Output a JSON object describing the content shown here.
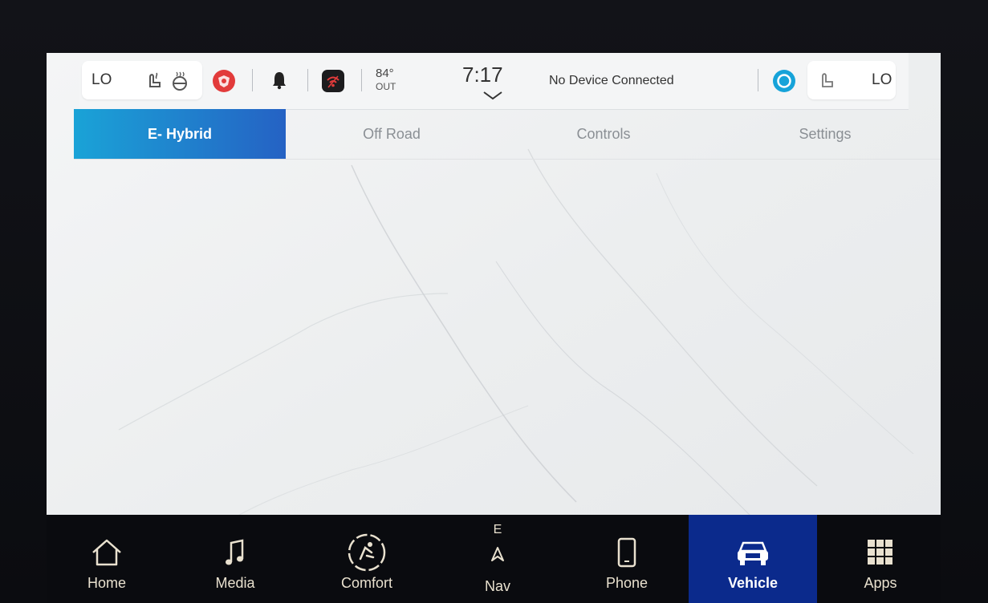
{
  "status_bar": {
    "left_climate_level": "LO",
    "right_climate_level": "LO",
    "temperature": "84°",
    "temperature_label": "OUT",
    "time": "7:17",
    "device_status": "No Device Connected",
    "icons": [
      "seat-heat-icon",
      "steering-wheel-heat-icon",
      "srt-logo-icon",
      "notification-bell-icon",
      "wifi-hotspot-icon",
      "chevron-down-icon",
      "alexa-icon",
      "seat-vent-icon"
    ]
  },
  "tabs": [
    {
      "label": "E- Hybrid",
      "active": true
    },
    {
      "label": "Off Road",
      "active": false
    },
    {
      "label": "Controls",
      "active": false
    },
    {
      "label": "Settings",
      "active": false
    }
  ],
  "nav": {
    "home": "Home",
    "media": "Media",
    "comfort": "Comfort",
    "nav": "Nav",
    "nav_heading": "E",
    "phone": "Phone",
    "vehicle": "Vehicle",
    "apps": "Apps",
    "active": "Vehicle"
  },
  "colors": {
    "tab_active_start": "#1aa3d7",
    "tab_active_end": "#2562c4",
    "nav_active": "#0b2a8c",
    "nav_label": "#e9e1cf",
    "alexa": "#16a3d9",
    "srt_red": "#e23b3b"
  }
}
